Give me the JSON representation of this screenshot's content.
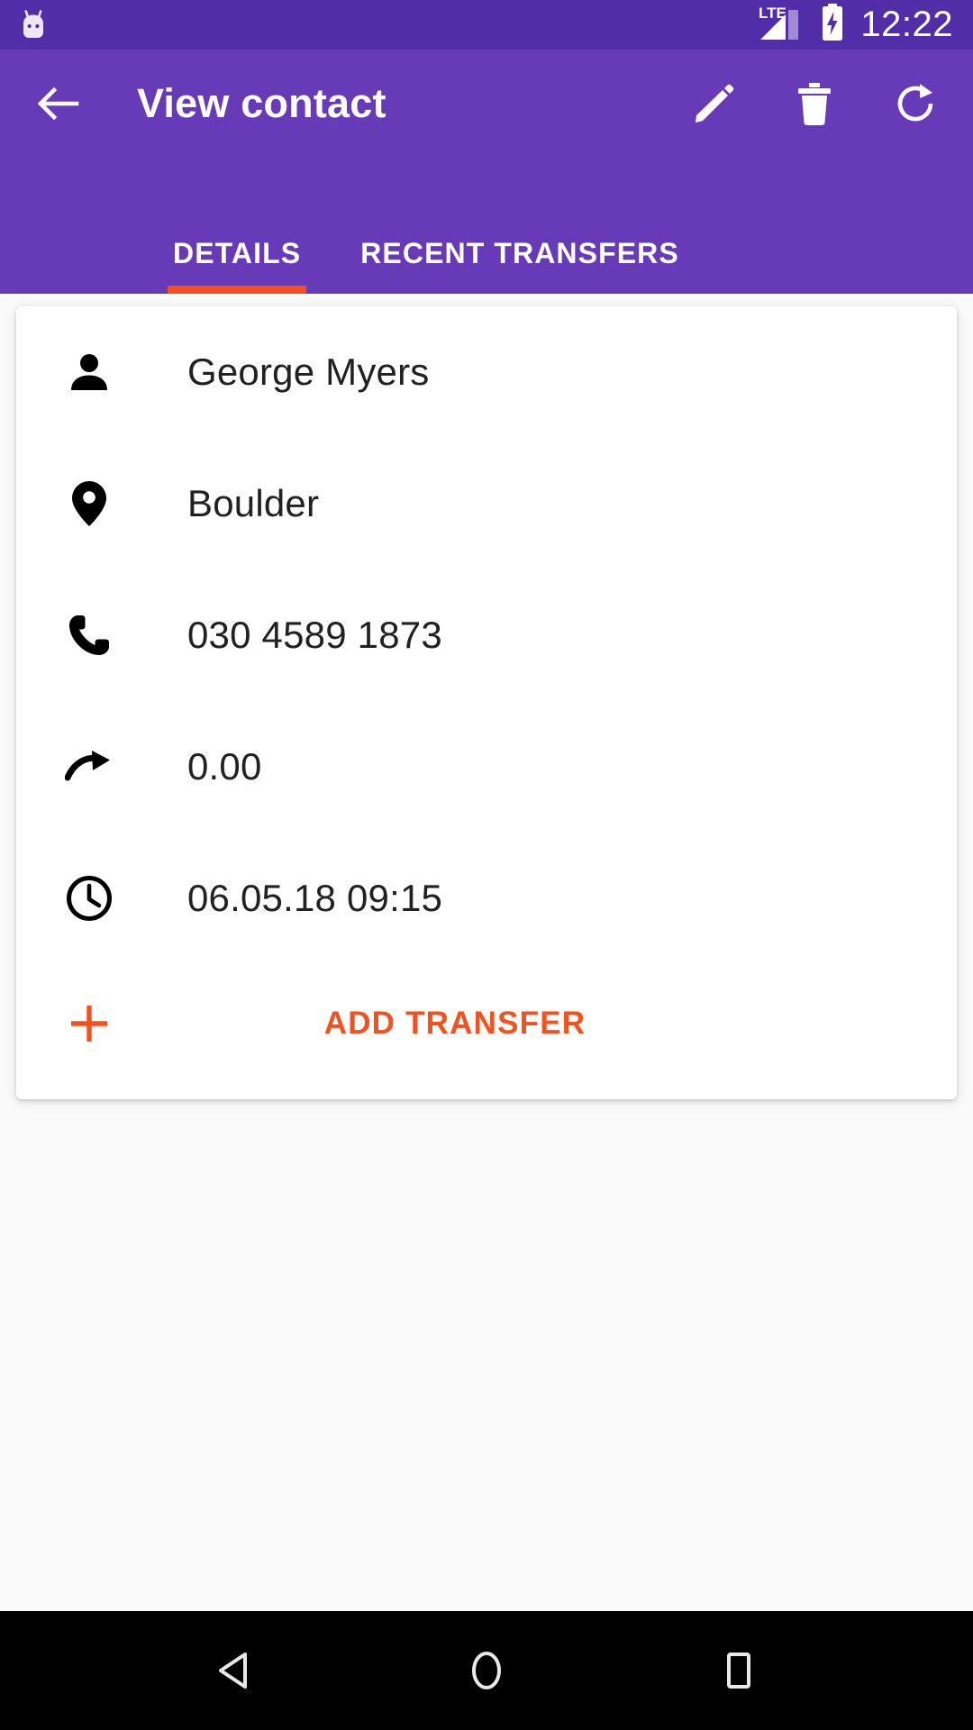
{
  "status_bar": {
    "notification_icon": "android-mascot-icon",
    "network_label": "LTE",
    "signal_icon": "signal-bars-icon",
    "battery_icon": "battery-charging-icon",
    "time": "12:22"
  },
  "app_bar": {
    "back_icon": "arrow-back-icon",
    "title": "View contact",
    "actions": [
      {
        "name": "edit-button",
        "icon": "pencil-icon"
      },
      {
        "name": "delete-button",
        "icon": "trash-icon"
      },
      {
        "name": "refresh-button",
        "icon": "refresh-icon"
      }
    ]
  },
  "tabs": {
    "items": [
      {
        "label": "DETAILS",
        "selected": true
      },
      {
        "label": "RECENT TRANSFERS",
        "selected": false
      }
    ],
    "indicator_color": "#F4511E"
  },
  "contact_card": {
    "rows": [
      {
        "icon": "person-icon",
        "value": "George Myers"
      },
      {
        "icon": "location-pin-icon",
        "value": "Boulder"
      },
      {
        "icon": "phone-icon",
        "value": "030 4589 1873"
      },
      {
        "icon": "transfer-arrow-icon",
        "value": "0.00"
      },
      {
        "icon": "clock-icon",
        "value": "06.05.18 09:15"
      }
    ],
    "add_transfer": {
      "icon": "plus-icon",
      "label": "ADD TRANSFER"
    }
  },
  "nav_bar": {
    "buttons": [
      {
        "name": "nav-back-button",
        "icon": "triangle-back-icon"
      },
      {
        "name": "nav-home-button",
        "icon": "circle-home-icon"
      },
      {
        "name": "nav-recents-button",
        "icon": "square-recents-icon"
      }
    ]
  },
  "colors": {
    "status_bar": "#512DA8",
    "app_bar": "#673AB7",
    "accent": "#F4511E",
    "background": "#FAFAFA",
    "card": "#FFFFFF",
    "text_primary": "#212121"
  }
}
